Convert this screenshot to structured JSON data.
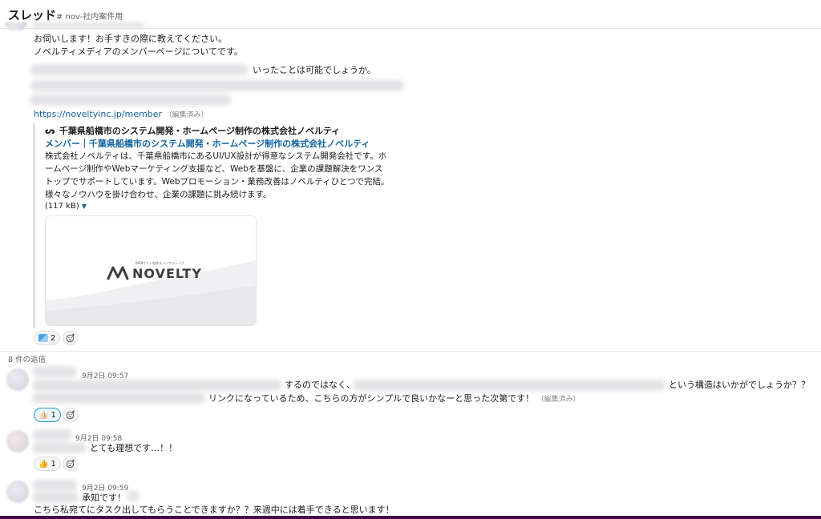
{
  "header": {
    "title": "スレッド",
    "channel": "# nov-社内案件用"
  },
  "parent": {
    "line1": "お伺いします！お手すきの際に教えてください。",
    "line2": "ノベルティメディアのメンバーページについてです。",
    "line3_tail": "いったことは可能でしょうか。",
    "link": "https://noveltyinc.jp/member",
    "edited": "（編集済み）",
    "unfurl": {
      "site": "千葉県船橋市のシステム開発・ホームページ制作の株式会社ノベルティ",
      "title": "メンバー｜千葉県船橋市のシステム開発・ホームページ制作の株式会社ノベルティ",
      "description": "株式会社ノベルティは、千葉県船橋市にあるUI/UX設計が得意なシステム開発会社です。ホームページ制作やWebマーケティング支援など、Webを基盤に、企業の課題解決をワンストップでサポートしています。Webプロモーション・業務改善はノベルティひとつで完結。様々なノウハウを掛け合わせ、企業の課題に挑み続けます。",
      "size": "(117 kB)",
      "logo_text": "NOVELTY",
      "logo_sub": "WEBサイト制作＆マーケティング"
    },
    "reaction_count": "2"
  },
  "reply_count_label": "8 件の返信",
  "replies": [
    {
      "time": "9月2日 09:57",
      "line1_mid": "するのではなく、",
      "line1_tail": "という構造はいかがでしょうか？？",
      "line2_tail": "リンクになっているため、こちらの方がシンプルで良いかなーと思った次第です！",
      "edited": "（編集済み）",
      "reaction_emoji": "👍🏻",
      "reaction_count": "1"
    },
    {
      "time": "9月2日 09:58",
      "text": "とても理想です…！！",
      "reaction_emoji": "👍",
      "reaction_count": "1"
    },
    {
      "time": "9月2日 09:59",
      "line1": "承知です！",
      "line2": "こちら私宛てにタスク出してもらうことできますか？？来週中には着手できると思います！"
    }
  ],
  "colors": {
    "link": "#1264a3",
    "brand_purple": "#3f0e40",
    "reaction_active": "#1d9bd1"
  }
}
